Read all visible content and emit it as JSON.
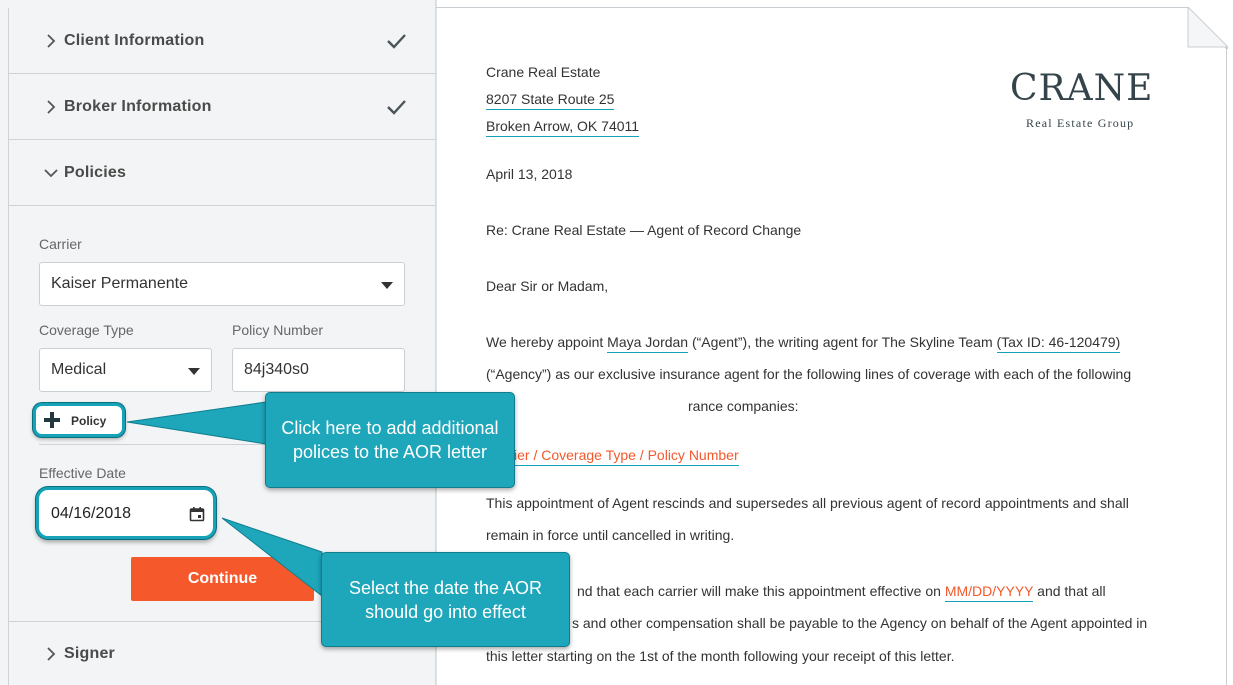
{
  "sections": {
    "client": {
      "title": "Client Information"
    },
    "broker": {
      "title": "Broker Information"
    },
    "policies": {
      "title": "Policies"
    },
    "signer": {
      "title": "Signer"
    }
  },
  "form": {
    "carrier_label": "Carrier",
    "carrier_value": "Kaiser Permanente",
    "coverage_label": "Coverage Type",
    "coverage_value": "Medical",
    "policy_number_label": "Policy Number",
    "policy_number_value": "84j340s0",
    "add_policy_label": "Policy",
    "effective_date_label": "Effective Date",
    "effective_date_value": "04/16/2018",
    "continue_label": "Continue"
  },
  "letter": {
    "company": "Crane Real Estate",
    "address1": "8207 State Route 25",
    "address2": "Broken Arrow, OK 74011",
    "date": "April 13, 2018",
    "re": "Re: Crane Real Estate — Agent of Record Change",
    "salutation": "Dear Sir or Madam,",
    "p1_a": "We hereby appoint ",
    "p1_agent": "Maya Jordan",
    "p1_b": " (“Agent”), the writing agent for The Skyline Team ",
    "p1_tax": "(Tax ID: 46-120479)",
    "p1_line2": "(“Agency”) as our exclusive insurance agent for the following lines of coverage with each of the following",
    "p1_line3_visible": "rance companies:",
    "policy_list_visible": "ier / Coverage Type / Policy Number",
    "p2_line1": "This appointment of Agent rescinds and supersedes all previous agent of record appointments and shall",
    "p2_line2": "remain in force until cancelled in writing.",
    "p3_line1_visible": "nd that each carrier will make this appointment effective on ",
    "p3_date": "MM/DD/YYYY",
    "p3_line1_end": " and that all",
    "p3_line2_visible": "s and other compensation shall be payable to the Agency on behalf of the Agent appointed in",
    "p3_line3": "this letter starting on the 1st of the month following your receipt of this letter."
  },
  "logo": {
    "word": "CRANE",
    "sub": "Real Estate Group"
  },
  "callouts": {
    "policy": "Click here to add additional polices to the AOR letter",
    "date": "Select the date the AOR should go into effect"
  },
  "colors": {
    "accent": "#16a3b8",
    "callout": "#1ea6bb",
    "button": "#f4582b",
    "panel_bg": "#f2f4f5"
  },
  "icons": {
    "chevron": "chevron-right-icon",
    "chevron_open": "chevron-down-icon",
    "check": "check-icon",
    "plus": "plus-icon",
    "calendar": "calendar-icon"
  }
}
